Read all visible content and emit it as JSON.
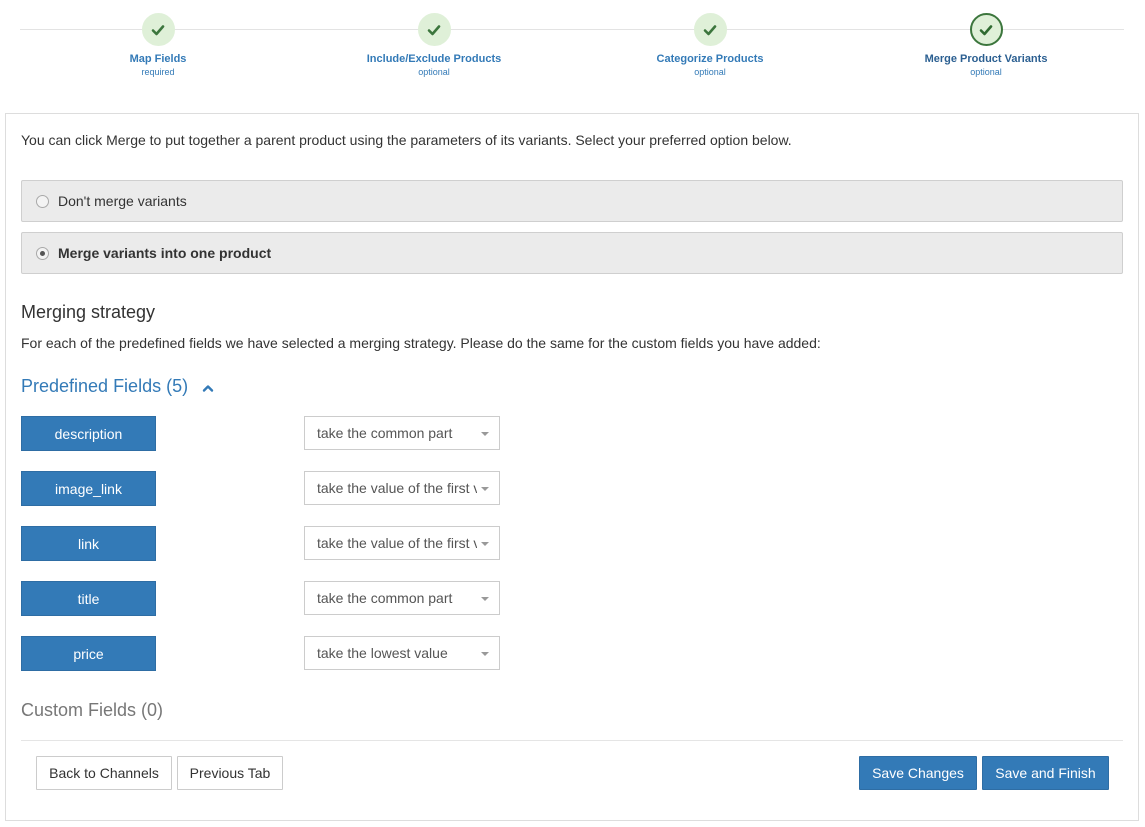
{
  "stepper": {
    "steps": [
      {
        "title": "Map Fields",
        "subtitle": "required",
        "status": "completed"
      },
      {
        "title": "Include/Exclude Products",
        "subtitle": "optional",
        "status": "completed"
      },
      {
        "title": "Categorize Products",
        "subtitle": "optional",
        "status": "completed"
      },
      {
        "title": "Merge Product Variants",
        "subtitle": "optional",
        "status": "active"
      }
    ]
  },
  "intro_text": "You can click Merge to put together a parent product using the parameters of its variants. Select your preferred option below.",
  "merge_options": [
    {
      "label": "Don't merge variants",
      "checked": false
    },
    {
      "label": "Merge variants into one product",
      "checked": true
    }
  ],
  "merging_strategy": {
    "title": "Merging strategy",
    "description": "For each of the predefined fields we have selected a merging strategy. Please do the same for the custom fields you have added:"
  },
  "predefined_fields": {
    "title": "Predefined Fields (5)",
    "expanded": true,
    "fields": [
      {
        "name": "description",
        "strategy": "take the common part"
      },
      {
        "name": "image_link",
        "strategy": "take the value of the first variant"
      },
      {
        "name": "link",
        "strategy": "take the value of the first variant"
      },
      {
        "name": "title",
        "strategy": "take the common part"
      },
      {
        "name": "price",
        "strategy": "take the lowest value"
      }
    ]
  },
  "custom_fields": {
    "title": "Custom Fields (0)"
  },
  "footer": {
    "back_label": "Back to Channels",
    "previous_label": "Previous Tab",
    "save_label": "Save Changes",
    "save_finish_label": "Save and Finish"
  },
  "colors": {
    "primary": "#337ab7",
    "success": "#3c763d",
    "success_bg": "#dff0d8",
    "option_bg": "#ebebeb"
  }
}
